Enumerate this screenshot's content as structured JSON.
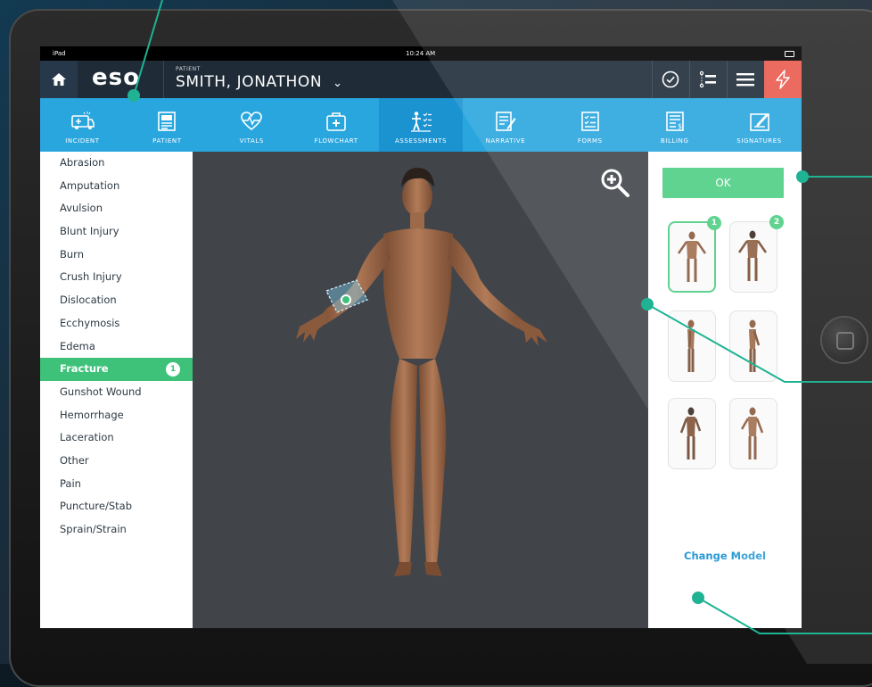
{
  "status_bar": {
    "device": "iPad",
    "time": "10:24 AM"
  },
  "header": {
    "logo": "eso",
    "patient_label": "PATIENT",
    "patient_name": "SMITH, JONATHON",
    "icons": [
      "home-icon",
      "check-circle-icon",
      "timeline-icon",
      "menu-icon",
      "bolt-icon"
    ]
  },
  "tabs": [
    {
      "label": "INCIDENT",
      "icon": "ambulance-icon"
    },
    {
      "label": "PATIENT",
      "icon": "patient-card-icon"
    },
    {
      "label": "VITALS",
      "icon": "heart-pulse-icon"
    },
    {
      "label": "FLOWCHART",
      "icon": "medkit-icon"
    },
    {
      "label": "ASSESSMENTS",
      "icon": "assessment-icon",
      "active": true
    },
    {
      "label": "NARRATIVE",
      "icon": "narrative-icon"
    },
    {
      "label": "FORMS",
      "icon": "forms-icon"
    },
    {
      "label": "BILLING",
      "icon": "billing-icon"
    },
    {
      "label": "SIGNATURES",
      "icon": "signature-icon"
    }
  ],
  "injury_list": {
    "items": [
      "Abrasion",
      "Amputation",
      "Avulsion",
      "Blunt Injury",
      "Burn",
      "Crush Injury",
      "Dislocation",
      "Ecchymosis",
      "Edema",
      "Fracture",
      "Gunshot Wound",
      "Hemorrhage",
      "Laceration",
      "Other",
      "Pain",
      "Puncture/Stab",
      "Sprain/Strain"
    ],
    "selected": "Fracture",
    "selected_count": "1"
  },
  "right_panel": {
    "ok_label": "OK",
    "thumbnail_badges": [
      "1",
      "2"
    ],
    "change_model_label": "Change Model"
  },
  "colors": {
    "header": "#1f2c38",
    "tabbar": "#2aa6df",
    "green": "#3ec27a",
    "viewer_bg": "#414449",
    "bolt": "#e95b4f"
  }
}
